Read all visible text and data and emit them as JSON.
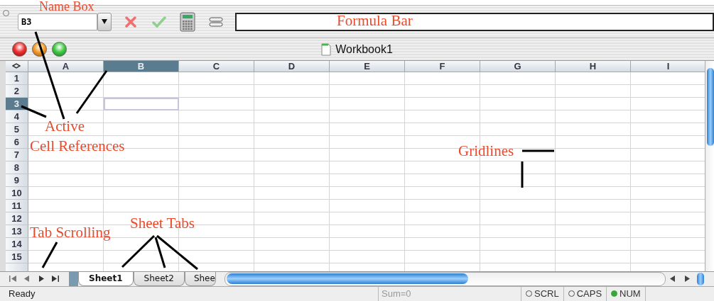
{
  "toolbar": {
    "name_box": "B3"
  },
  "window": {
    "title": "Workbook1"
  },
  "columns": [
    {
      "label": "A",
      "selected": false
    },
    {
      "label": "B",
      "selected": true
    },
    {
      "label": "C",
      "selected": false
    },
    {
      "label": "D",
      "selected": false
    },
    {
      "label": "E",
      "selected": false
    },
    {
      "label": "F",
      "selected": false
    },
    {
      "label": "G",
      "selected": false
    },
    {
      "label": "H",
      "selected": false
    },
    {
      "label": "I",
      "selected": false
    }
  ],
  "rows": [
    {
      "label": "1",
      "selected": false
    },
    {
      "label": "2",
      "selected": false
    },
    {
      "label": "3",
      "selected": true
    },
    {
      "label": "4",
      "selected": false
    },
    {
      "label": "5",
      "selected": false
    },
    {
      "label": "6",
      "selected": false
    },
    {
      "label": "7",
      "selected": false
    },
    {
      "label": "8",
      "selected": false
    },
    {
      "label": "9",
      "selected": false
    },
    {
      "label": "10",
      "selected": false
    },
    {
      "label": "11",
      "selected": false
    },
    {
      "label": "12",
      "selected": false
    },
    {
      "label": "13",
      "selected": false
    },
    {
      "label": "14",
      "selected": false
    },
    {
      "label": "15",
      "selected": false
    }
  ],
  "sheet_tabs": [
    {
      "label": "Sheet1",
      "selected": true
    },
    {
      "label": "Sheet2",
      "selected": false
    },
    {
      "label": "Shee",
      "selected": false
    }
  ],
  "status_bar": {
    "message": "Ready",
    "sum": "Sum=0",
    "indicators": [
      {
        "label": "SCRL",
        "on": false
      },
      {
        "label": "CAPS",
        "on": false
      },
      {
        "label": "NUM",
        "on": true
      }
    ]
  },
  "annotations": [
    {
      "text": "Name Box"
    },
    {
      "text": "Formula Bar"
    },
    {
      "text": "Active"
    },
    {
      "text": "Cell References"
    },
    {
      "text": "Gridlines"
    },
    {
      "text": "Tab Scrolling"
    },
    {
      "text": "Sheet Tabs"
    }
  ]
}
